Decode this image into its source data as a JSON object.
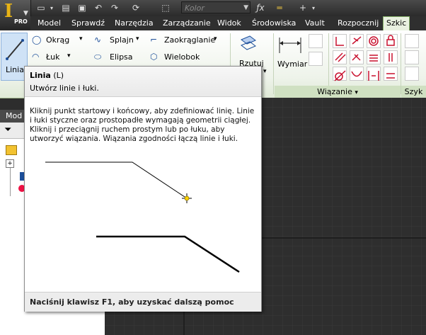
{
  "app": {
    "badge": "PRO",
    "color_field_placeholder": "Kolor"
  },
  "tabs": [
    "Model",
    "Sprawdź",
    "Narzędzia",
    "Zarządzanie",
    "Widok",
    "Środowiska",
    "Vault",
    "Rozpocznij",
    "Szkic"
  ],
  "active_tab": "Szkic",
  "ribbon": {
    "line_tool": "Linia",
    "okrag": "Okrąg",
    "luk": "Łuk",
    "splajn": "Splajn",
    "elipsa": "Elipsa",
    "zaokraglanie": "Zaokrąglanie",
    "wielobok": "Wielobok",
    "rzutuj": "Rzutuj",
    "wymiar": "Wymiar",
    "constraints_panel": "Wiązanie",
    "pattern_panel": "Szyk"
  },
  "browser": {
    "title": "Mod"
  },
  "tooltip": {
    "title": "Linia",
    "shortcut": "(L)",
    "subtitle": "Utwórz linie i łuki.",
    "description": "Kliknij punkt startowy i końcowy, aby zdefiniować linię. Linie i łuki styczne oraz prostopadłe wymagają geometrii ciągłej. Kliknij i przeciągnij ruchem prostym lub po łuku, aby utworzyć wiązania. Wiązania zgodności łączą linie i łuki.",
    "help": "Naciśnij klawisz F1, aby uzyskać dalszą pomoc"
  }
}
